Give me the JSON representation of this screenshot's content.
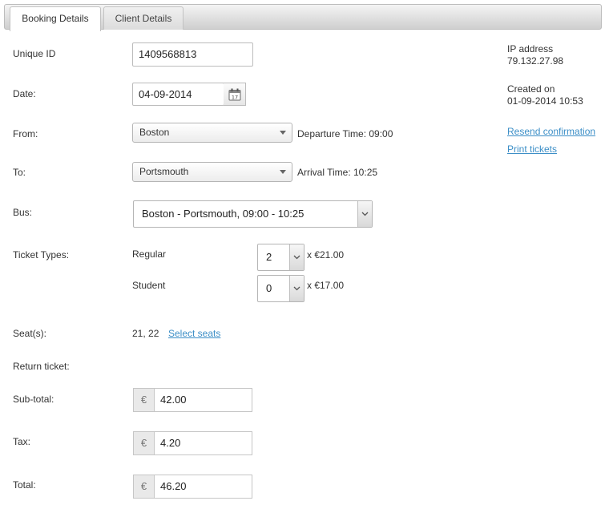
{
  "tabs": {
    "booking": "Booking Details",
    "client": "Client Details"
  },
  "labels": {
    "unique_id": "Unique ID",
    "date": "Date:",
    "from": "From:",
    "to": "To:",
    "bus": "Bus:",
    "ticket_types": "Ticket Types:",
    "seats": "Seat(s):",
    "return_ticket": "Return ticket:",
    "subtotal": "Sub-total:",
    "tax": "Tax:",
    "total": "Total:"
  },
  "booking": {
    "unique_id": "1409568813",
    "date": "04-09-2014",
    "calendar_day": "17",
    "from": "Boston",
    "departure_time": "Departure Time: 09:00",
    "to": "Portsmouth",
    "arrival_time": "Arrival Time: 10:25",
    "bus": "Boston - Portsmouth, 09:00 - 10:25",
    "tickets": [
      {
        "type": "Regular",
        "qty": "2",
        "price": "x €21.00"
      },
      {
        "type": "Student",
        "qty": "0",
        "price": "x €17.00"
      }
    ],
    "seats": "21, 22",
    "select_seats_link": "Select seats",
    "currency": "€",
    "subtotal": "42.00",
    "tax": "4.20",
    "total": "46.20"
  },
  "info": {
    "ip_label": "IP address",
    "ip_value": "79.132.27.98",
    "created_label": "Created on",
    "created_value": "01-09-2014 10:53",
    "resend_link": "Resend confirmation",
    "print_link": "Print tickets"
  }
}
